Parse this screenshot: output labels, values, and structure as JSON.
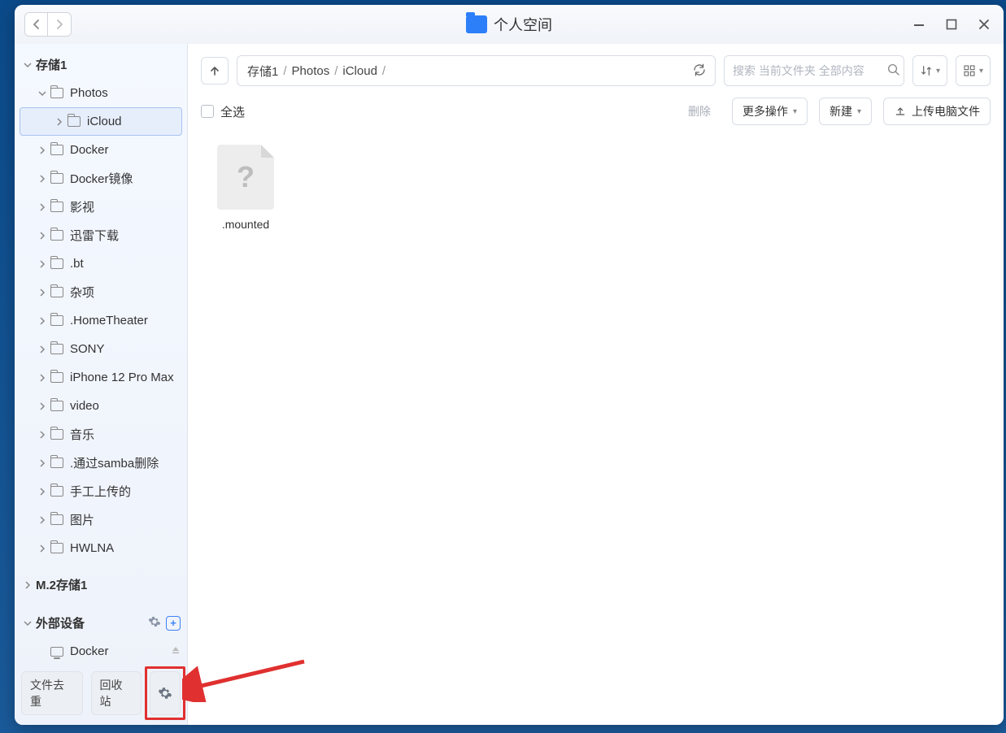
{
  "titlebar": {
    "title": "个人空间"
  },
  "sidebar": {
    "storage_root": "存储1",
    "photos": "Photos",
    "icloud": "iCloud",
    "items": [
      "Docker",
      "Docker镜像",
      "影视",
      "迅雷下载",
      ".bt",
      "杂项",
      ".HomeTheater",
      "SONY",
      "iPhone 12 Pro Max",
      "video",
      "音乐",
      ".通过samba删除",
      "手工上传的",
      "图片",
      "HWLNA"
    ],
    "m2_storage": "M.2存储1",
    "external_devices": "外部设备",
    "ext_docker": "Docker",
    "footer": {
      "dedupe": "文件去重",
      "trash": "回收站"
    }
  },
  "toolbar": {
    "path": [
      "存储1",
      "Photos",
      "iCloud"
    ],
    "search_placeholder": "搜索 当前文件夹 全部内容"
  },
  "actions": {
    "select_all": "全选",
    "delete": "删除",
    "more": "更多操作",
    "new": "新建",
    "upload": "上传电脑文件"
  },
  "files": [
    {
      "name": ".mounted"
    }
  ]
}
